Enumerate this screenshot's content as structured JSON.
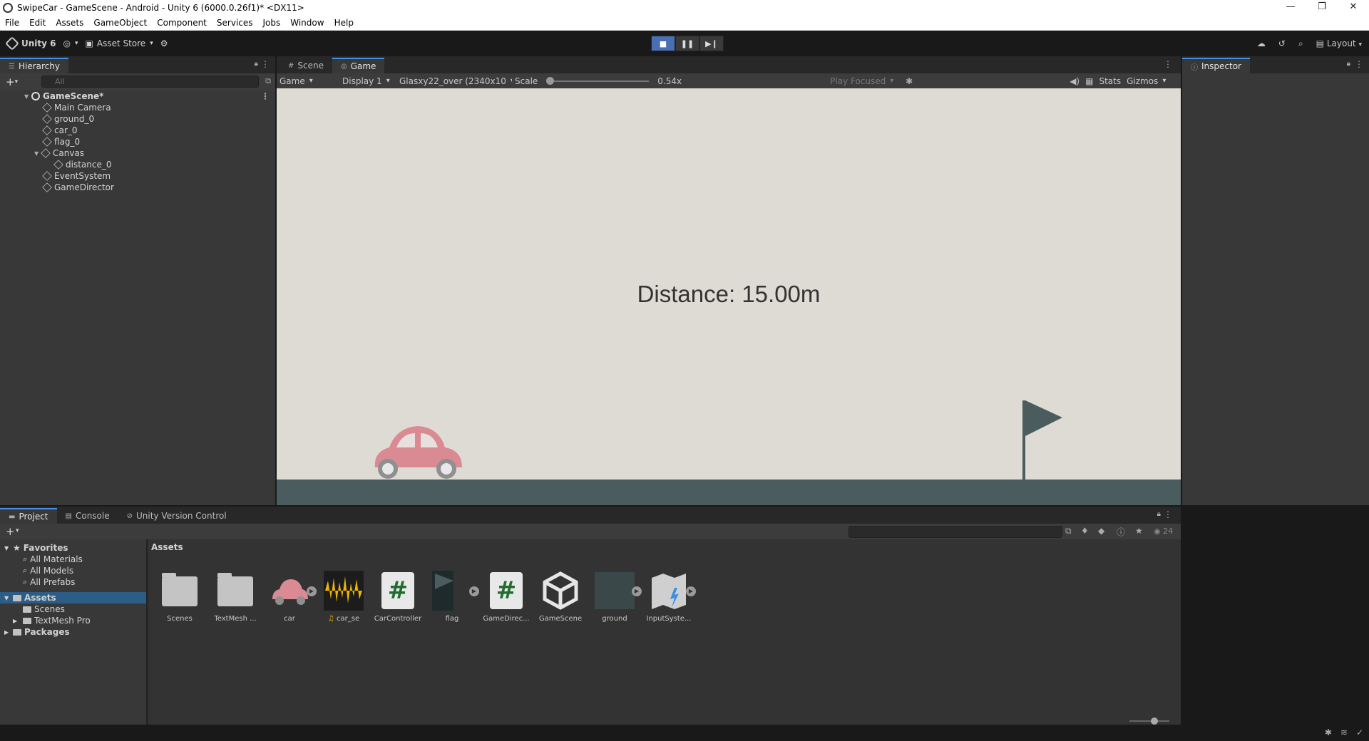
{
  "window": {
    "title": "SwipeCar - GameScene - Android - Unity 6 (6000.0.26f1)* <DX11>",
    "controls": [
      "—",
      "❐",
      "✕"
    ]
  },
  "menu": [
    "File",
    "Edit",
    "Assets",
    "GameObject",
    "Component",
    "Services",
    "Jobs",
    "Window",
    "Help"
  ],
  "toolbar": {
    "unity_label": "Unity 6",
    "asset_store": "Asset Store",
    "layout": "Layout",
    "play_buttons": [
      "■",
      "❚❚",
      "▶❙"
    ]
  },
  "hierarchy": {
    "tab": "Hierarchy",
    "search_placeholder": "All",
    "items": [
      {
        "label": "GameScene*"
      },
      {
        "label": "Main Camera"
      },
      {
        "label": "ground_0"
      },
      {
        "label": "car_0"
      },
      {
        "label": "flag_0"
      },
      {
        "label": "Canvas"
      },
      {
        "label": "distance_0"
      },
      {
        "label": "EventSystem"
      },
      {
        "label": "GameDirector"
      }
    ]
  },
  "game_view": {
    "tabs": [
      "Scene",
      "Game"
    ],
    "active_tab": "Game",
    "bar": {
      "mode": "Game",
      "display": "Display 1",
      "resolution": "Glasxy22_over (2340x10",
      "scale_label": "Scale",
      "scale_value": "0.54x",
      "play_focused": "Play Focused",
      "stats": "Stats",
      "gizmos": "Gizmos"
    },
    "distance_text": "Distance: 15.00m",
    "colors": {
      "background": "#dedbd4",
      "ground": "#4b5c5e",
      "car": "#d98a92",
      "flag": "#4b5c5e"
    }
  },
  "inspector": {
    "tab": "Inspector"
  },
  "project": {
    "tabs": [
      "Project",
      "Console",
      "Unity Version Control"
    ],
    "count": "24",
    "sidebar": {
      "favorites": "Favorites",
      "favorite_items": [
        "All Materials",
        "All Models",
        "All Prefabs"
      ],
      "assets": "Assets",
      "asset_items": [
        "Scenes",
        "TextMesh Pro"
      ],
      "packages": "Packages"
    },
    "breadcrumb": "Assets",
    "assets": [
      {
        "label": "Scenes",
        "icon": "folder-icon"
      },
      {
        "label": "TextMesh ...",
        "icon": "folder-icon"
      },
      {
        "label": "car",
        "icon": "sprite-icon"
      },
      {
        "label": "car_se",
        "icon": "audio-icon"
      },
      {
        "label": "CarController",
        "icon": "script-icon"
      },
      {
        "label": "flag",
        "icon": "sprite-icon"
      },
      {
        "label": "GameDirec...",
        "icon": "script-icon"
      },
      {
        "label": "GameScene",
        "icon": "unity-scene-icon"
      },
      {
        "label": "ground",
        "icon": "sprite-icon"
      },
      {
        "label": "InputSyste...",
        "icon": "input-system-icon"
      }
    ]
  }
}
